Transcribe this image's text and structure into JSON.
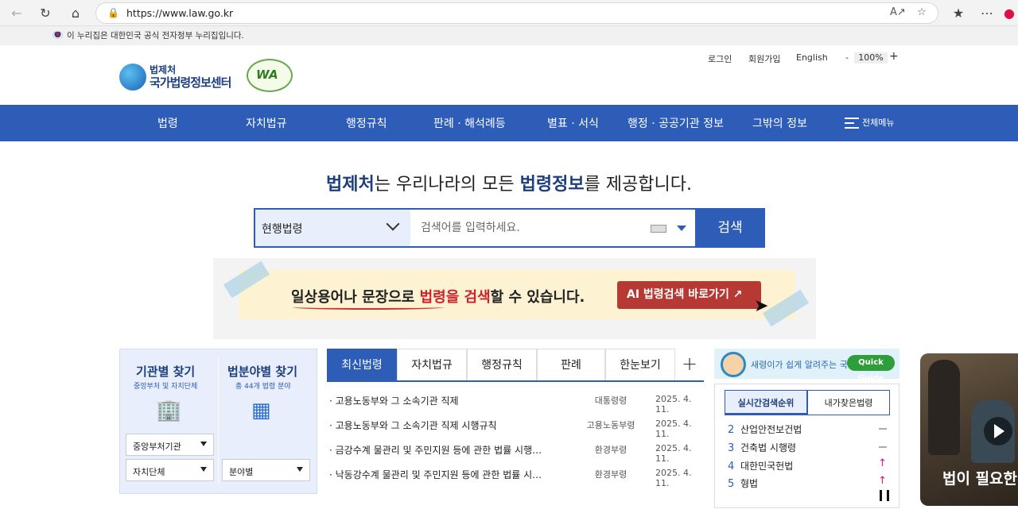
{
  "browser": {
    "url": "https://www.law.go.kr"
  },
  "gov_banner": "이 누리집은 대한민국 공식 전자정부 누리집입니다.",
  "header": {
    "logo_sub": "법제처",
    "logo_main": "국가법령정보센터",
    "wa_badge": "WA",
    "util": {
      "login": "로그인",
      "join": "회원가입",
      "english": "English",
      "zoom_minus": "-",
      "zoom": "100%",
      "zoom_plus": "+"
    }
  },
  "gnb": {
    "items": [
      "법령",
      "자치법규",
      "행정규칙",
      "판례 · 해석례등",
      "별표 · 서식",
      "행정 · 공공기관 정보",
      "그밖의 정보"
    ],
    "all_menu": "전체메뉴"
  },
  "hero": {
    "b1": "법제처",
    "t1": "는 우리나라의 모든 ",
    "b2": "법령정보",
    "t2": "를 제공합니다."
  },
  "search": {
    "scope": "현행법령",
    "placeholder": "검색어를 입력하세요.",
    "button": "검색"
  },
  "ai_banner": {
    "text_a": "일상용어나 문장으로 ",
    "text_red": "법령을 검색",
    "text_b": "할 수 있습니다.",
    "button": "AI 법령검색 바로가기 ↗"
  },
  "finder": {
    "org_title": "기관별 찾기",
    "org_sub": "중앙부처 및 자치단체",
    "field_title": "법분야별 찾기",
    "field_sub": "총 44개 법령 분야",
    "sel_central": "중앙부처기관",
    "sel_local": "자치단체",
    "sel_field": "분야별"
  },
  "tabs": {
    "items": [
      "최신법령",
      "자치법규",
      "행정규칙",
      "판례",
      "한눈보기"
    ],
    "plus": "+"
  },
  "laws": [
    {
      "title": "· 고용노동부와 그 소속기관 직제",
      "org": "대통령령",
      "date": "2025. 4. 11."
    },
    {
      "title": "· 고용노동부와 그 소속기관 직제 시행규칙",
      "org": "고용노동부령",
      "date": "2025. 4. 11."
    },
    {
      "title": "· 금강수계 물관리 및 주민지원 등에 관한 법률 시행…",
      "org": "환경부령",
      "date": "2025. 4. 11."
    },
    {
      "title": "· 낙동강수계 물관리 및 주민지원 등에 관한 법률 시…",
      "org": "환경부령",
      "date": "2025. 4. 11."
    }
  ],
  "quick_guide": {
    "text": "새령이가 쉽게 알려주는 국법",
    "pill": "Quick Guide"
  },
  "ranking": {
    "tab_live": "실시간검색순위",
    "tab_mine": "내가찾은법령",
    "items": [
      {
        "rank": "2",
        "name": "산업안전보건법",
        "trend": "same"
      },
      {
        "rank": "3",
        "name": "건축법 시행령",
        "trend": "same"
      },
      {
        "rank": "4",
        "name": "대한민국헌법",
        "trend": "up"
      },
      {
        "rank": "5",
        "name": "형법",
        "trend": "up"
      }
    ],
    "up_symbol": "↑"
  },
  "video": {
    "caption": "법이 필요한"
  },
  "colors": {
    "primary": "#2e5db8",
    "navy": "#1d3f7d",
    "accent_red": "#b63a33"
  }
}
